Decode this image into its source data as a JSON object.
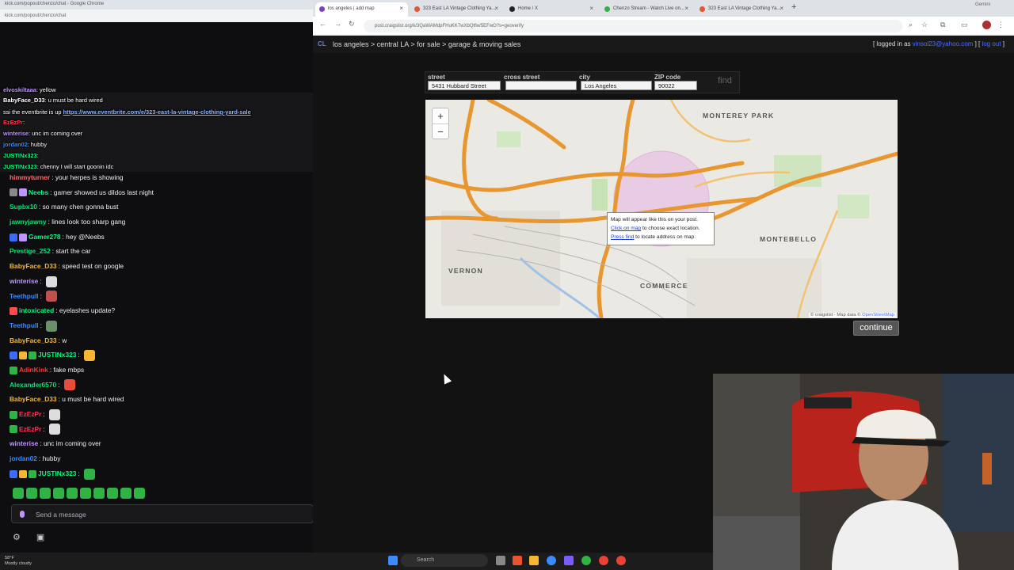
{
  "left_window": {
    "title": "kick.com/popout/chenzo/chat - Google Chrome",
    "url": "kick.com/popout/chenzo/chat"
  },
  "chat_overlay": [
    {
      "user": "elvoskiltaaa",
      "text": "yellow"
    },
    {
      "user": "BabyFace_D33",
      "text": "u must be hard wired"
    },
    {
      "user": "",
      "text": "ssi the eventbrite is up",
      "link": "https://www.eventbrite.com/e/323-east-la-vintage-clothing-yard-sale"
    },
    {
      "user": "EzEzPr",
      "text": ""
    },
    {
      "user": "winterise",
      "text": "unc im coming over"
    },
    {
      "user": "jordan02",
      "text": "hubby"
    },
    {
      "user": "JUSTINx323",
      "text": ""
    },
    {
      "user": "JUSTINx323",
      "text": "chenny I will start goonin idc"
    }
  ],
  "chat": [
    {
      "user": "himmyturner",
      "color": "#ff6b6b",
      "text": "your herpes is showing"
    },
    {
      "user": "Neebs",
      "color": "#00ff7f",
      "text": "gamer showed us dildos last night",
      "badges": [
        "#888",
        "#bf94ff"
      ]
    },
    {
      "user": "Supbx10",
      "color": "#00e676",
      "text": "so many chen gonna bust"
    },
    {
      "user": "jawnyjawny",
      "color": "#00e676",
      "text": "lines look too sharp gang"
    },
    {
      "user": "Gamer278",
      "color": "#00ff7f",
      "text": "hey @Neebs",
      "badges": [
        "#3b6bff",
        "#bf94ff"
      ]
    },
    {
      "user": "Prestige_252",
      "color": "#00e676",
      "text": "start the car"
    },
    {
      "user": "BabyFace_D33",
      "color": "#f5b731",
      "text": "speed test on google"
    },
    {
      "user": "winterise",
      "color": "#bf94ff",
      "text": "",
      "emote": "#ddd"
    },
    {
      "user": "Teethpull",
      "color": "#3b8bff",
      "text": "",
      "emote": "#c0504d"
    },
    {
      "user": "intoxicated",
      "color": "#00ff7f",
      "text": "eyelashes update?",
      "badges": [
        "#ff4d4d"
      ]
    },
    {
      "user": "Teethpull",
      "color": "#3b8bff",
      "text": "",
      "emote": "#6b8e6b"
    },
    {
      "user": "BabyFace_D33",
      "color": "#f5b731",
      "text": "w"
    },
    {
      "user": "JUSTINx323",
      "color": "#00ff7f",
      "text": "",
      "emote": "#f5b731",
      "badges": [
        "#3b6bff",
        "#f5b731",
        "#2fb344"
      ]
    },
    {
      "user": "AdinKink",
      "color": "#ff3333",
      "text": "fake mbps",
      "badges": [
        "#2fb344"
      ]
    },
    {
      "user": "Alexander6570",
      "color": "#00e676",
      "text": "",
      "emote": "#e84c3d"
    },
    {
      "user": "BabyFace_D33",
      "color": "#f5b731",
      "text": "u must be hard wired"
    },
    {
      "user": "EzEzPr",
      "color": "#ff3355",
      "text": "",
      "emote": "#ddd",
      "badges": [
        "#2fb344"
      ]
    },
    {
      "user": "EzEzPr",
      "color": "#ff3355",
      "text": "",
      "emote": "#ddd",
      "badges": [
        "#2fb344"
      ]
    },
    {
      "user": "winterise",
      "color": "#bf94ff",
      "text": "unc im coming over"
    },
    {
      "user": "jordan02",
      "color": "#3b8bff",
      "text": "hubby"
    },
    {
      "user": "JUSTINx323",
      "color": "#00ff7f",
      "text": "",
      "emote": "#2fb344",
      "badges": [
        "#3b6bff",
        "#f5b731",
        "#2fb344"
      ]
    }
  ],
  "chat_input": {
    "placeholder": "Send a message"
  },
  "browser": {
    "tabs": [
      {
        "label": "los angeles | add map",
        "color": "#7b3fbf",
        "active": true
      },
      {
        "label": "323 East LA Vintage Clothing Ya...",
        "color": "#e8542f",
        "active": false
      },
      {
        "label": "Home / X",
        "color": "#222",
        "active": false
      },
      {
        "label": "Chenzo Stream - Watch Live on...",
        "color": "#2fb344",
        "active": false
      },
      {
        "label": "323 East LA Vintage Clothing Ya...",
        "color": "#e8542f",
        "active": false
      }
    ],
    "tab_extra": "Gemini",
    "url": "post.craigslist.org/k/3QaWAMdpFHuKK7wXbQtfw/5EFwO?s=geoverify"
  },
  "craigslist": {
    "logo": "CL",
    "breadcrumb": "los angeles > central LA > for sale > garage & moving sales",
    "login_prefix": "[ logged in as ",
    "login_email": "vinsol23@yahoo.com",
    "login_mid": " ] [ ",
    "logout": "log out",
    "login_suffix": " ]",
    "form": {
      "street_label": "street",
      "street_value": "5431 Hubbard Street",
      "cross_label": "cross street",
      "cross_value": "",
      "city_label": "city",
      "city_value": "Los Angeles",
      "zip_label": "ZIP code",
      "zip_value": "90022",
      "find_label": "find"
    },
    "map": {
      "labels": [
        "MONTEREY PARK",
        "MONTEBELLO",
        "VERNON",
        "COMMERCE"
      ],
      "message_line1": "Map will appear like this on your post.",
      "message_link2": "Click on map",
      "message_rest2": " to choose exact location.",
      "message_link3": "Press find",
      "message_rest3": " to locate address on map.",
      "attribution_prefix": "© craigslist - Map data © ",
      "attribution_link": "OpenStreetMap"
    },
    "continue_label": "continue"
  },
  "taskbar": {
    "weather_temp": "58°F",
    "weather_desc": "Mostly cloudy",
    "search_placeholder": "Search"
  }
}
